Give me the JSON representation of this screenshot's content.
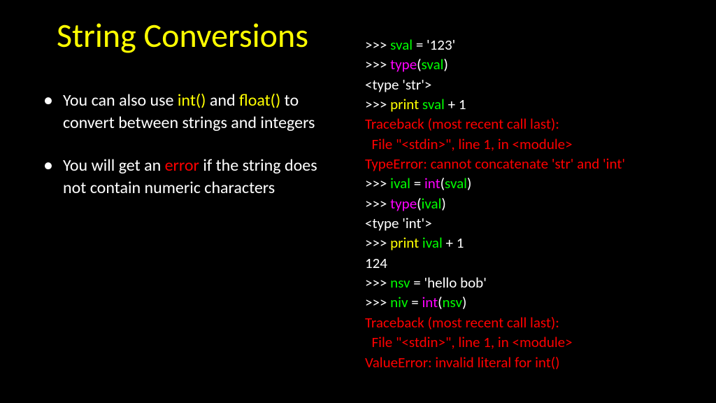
{
  "title": "String Conversions",
  "bullet1": {
    "p1": "You can also use ",
    "p2": "int()",
    "p3": " and ",
    "p4": "float()",
    "p5": " to convert between strings and integers"
  },
  "bullet2": {
    "p1": "You will get an ",
    "p2": "error",
    "p3": " if the string does not contain numeric characters"
  },
  "code": {
    "l1a": ">>> ",
    "l1b": "sval",
    "l1c": " = '123'",
    "l2a": ">>> ",
    "l2b": "type",
    "l2c": "(",
    "l2d": "sval",
    "l2e": ")",
    "l3": "<type 'str'>",
    "l4a": ">>> ",
    "l4b": "print ",
    "l4c": "sval",
    "l4d": " + 1",
    "l5": "Traceback (most recent call last):",
    "l6": "  File \"<stdin>\", line 1, in <module>",
    "l7": "TypeError: cannot concatenate 'str' and 'int'",
    "l8a": ">>> ",
    "l8b": "ival",
    "l8c": " = ",
    "l8d": "int",
    "l8e": "(",
    "l8f": "sval",
    "l8g": ")",
    "l9a": ">>> ",
    "l9b": "type",
    "l9c": "(",
    "l9d": "ival",
    "l9e": ")",
    "l10": "<type 'int'>",
    "l11a": ">>> ",
    "l11b": "print ",
    "l11c": "ival",
    "l11d": " + 1",
    "l12": "124",
    "l13a": ">>> ",
    "l13b": "nsv",
    "l13c": " = 'hello bob'",
    "l14a": ">>> ",
    "l14b": "niv",
    "l14c": " = ",
    "l14d": "int",
    "l14e": "(",
    "l14f": "nsv",
    "l14g": ")",
    "l15": "Traceback (most recent call last):",
    "l16": "  File \"<stdin>\", line 1, in <module>",
    "l17": "ValueError: invalid literal for int()"
  }
}
